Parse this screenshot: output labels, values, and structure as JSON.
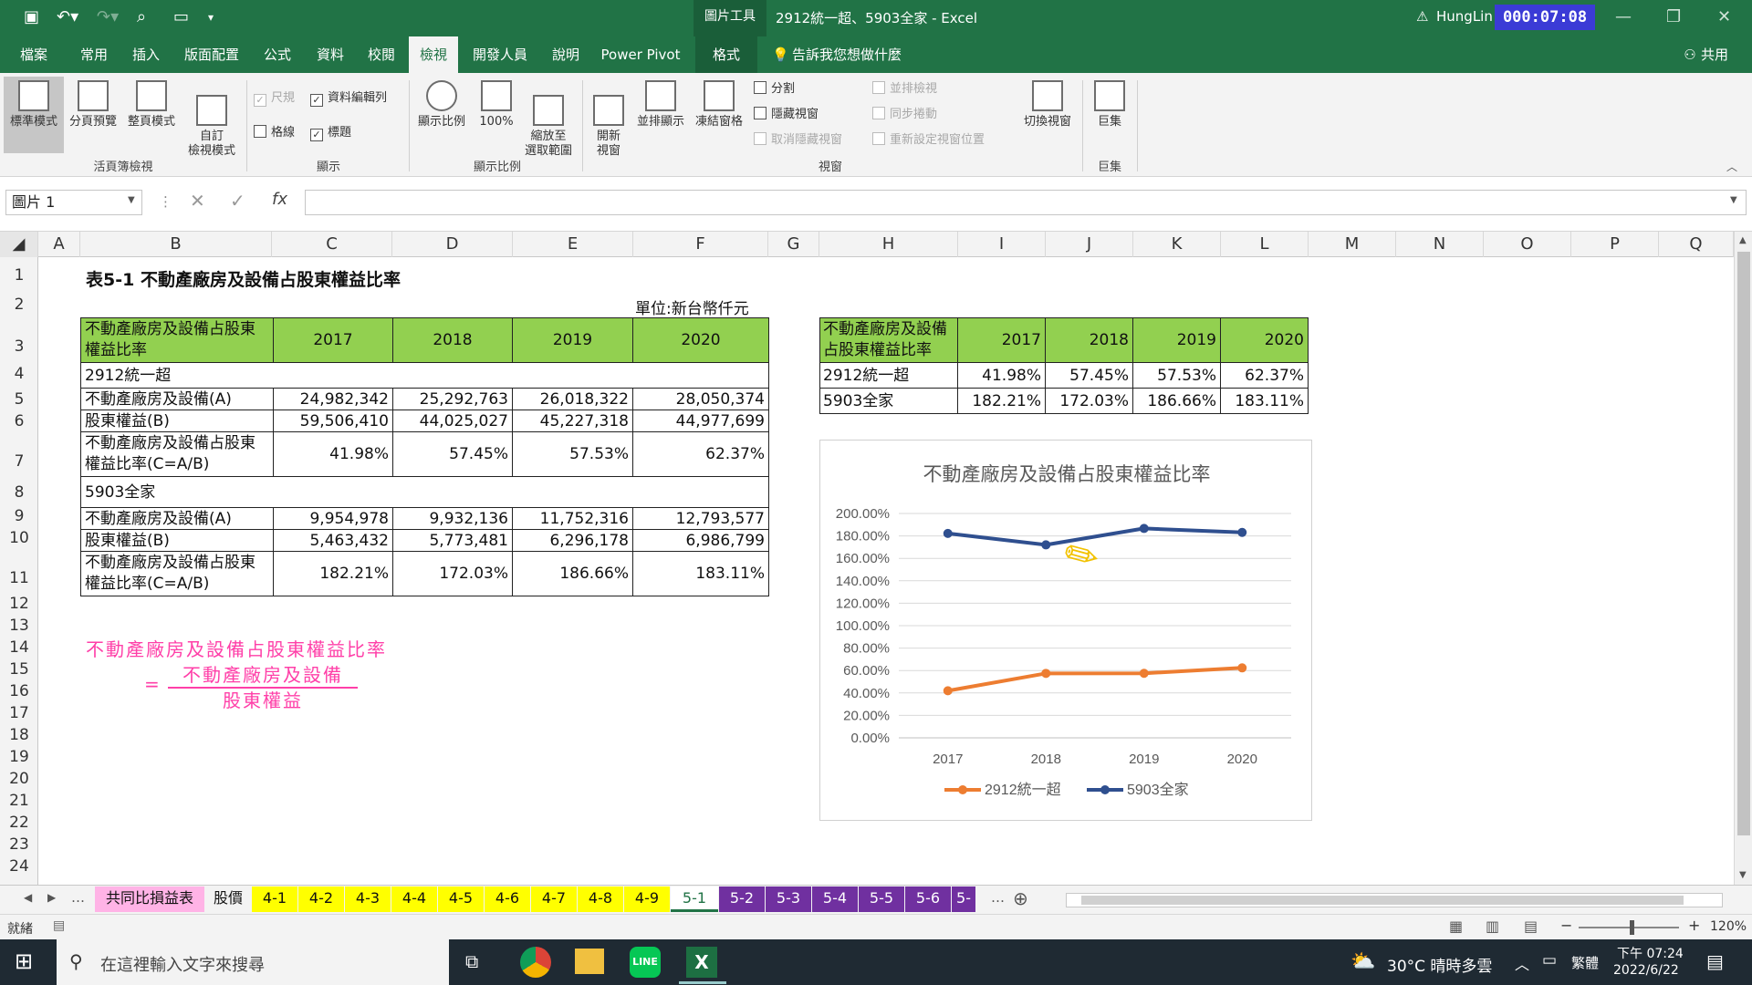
{
  "titlebar": {
    "context_tab": "圖片工具",
    "title": "2912統一超、5903全家 - Excel",
    "user": "HungLin",
    "recording_time": "000:07:08"
  },
  "ribbon_tabs": [
    "檔案",
    "常用",
    "插入",
    "版面配置",
    "公式",
    "資料",
    "校閱",
    "檢視",
    "開發人員",
    "說明",
    "Power Pivot",
    "格式"
  ],
  "active_tab": "檢視",
  "tell_me": "告訴我您想做什麼",
  "share": "共用",
  "ribbon": {
    "normal": "標準模式",
    "page_break": "分頁預覽",
    "page_layout": "整頁模式",
    "custom_view": "自訂\n檢視模式",
    "group_workbook_views": "活頁簿檢視",
    "ruler": "尺規",
    "formula_bar": "資料編輯列",
    "gridlines": "格線",
    "headings": "標題",
    "group_show": "顯示",
    "zoom": "顯示比例",
    "zoom100": "100%",
    "zoom_selection": "縮放至\n選取範圍",
    "group_zoom": "顯示比例",
    "new_window": "開新\n視窗",
    "arrange_all": "並排顯示",
    "freeze": "凍結窗格",
    "split": "分割",
    "hide": "隱藏視窗",
    "unhide": "取消隱藏視窗",
    "side_by_side": "並排檢視",
    "sync_scroll": "同步捲動",
    "reset_pos": "重新設定視窗位置",
    "switch_windows": "切換視窗",
    "group_window": "視窗",
    "macros": "巨集",
    "group_macros": "巨集"
  },
  "namebox": "圖片 1",
  "columns": [
    "A",
    "B",
    "C",
    "D",
    "E",
    "F",
    "G",
    "H",
    "I",
    "J",
    "K",
    "L",
    "M",
    "N",
    "O",
    "P",
    "Q"
  ],
  "rows": [
    "1",
    "2",
    "3",
    "4",
    "5",
    "6",
    "7",
    "8",
    "9",
    "10",
    "11",
    "12",
    "13",
    "14",
    "15",
    "16",
    "17",
    "18",
    "19",
    "20",
    "21",
    "22",
    "23",
    "24"
  ],
  "sheet": {
    "title": "表5-1 不動產廠房及設備占股東權益比率",
    "unit": "單位:新台幣仟元",
    "header_label": "不動產廠房及設備占股東權益比率",
    "years": [
      "2017",
      "2018",
      "2019",
      "2020"
    ],
    "company1": "2912統一超",
    "company2": "5903全家",
    "row_ppe": "不動產廠房及設備(A)",
    "row_equity": "股東權益(B)",
    "row_ratio": "不動產廠房及設備占股東權益比率(C=A/B)",
    "c1_ppe": [
      "24,982,342",
      "25,292,763",
      "26,018,322",
      "28,050,374"
    ],
    "c1_equity": [
      "59,506,410",
      "44,025,027",
      "45,227,318",
      "44,977,699"
    ],
    "c1_ratio": [
      "41.98%",
      "57.45%",
      "57.53%",
      "62.37%"
    ],
    "c2_ppe": [
      "9,954,978",
      "9,932,136",
      "11,752,316",
      "12,793,577"
    ],
    "c2_equity": [
      "5,463,432",
      "5,773,481",
      "6,296,178",
      "6,986,799"
    ],
    "c2_ratio": [
      "182.21%",
      "172.03%",
      "186.66%",
      "183.11%"
    ],
    "formula_line1": "不動產廠房及設備占股東權益比率",
    "formula_eq": "=",
    "formula_num": "不動產廠房及設備",
    "formula_den": "股東權益",
    "summary_header": "不動產廠房及設備占股東權益比率"
  },
  "chart_data": {
    "type": "line",
    "title": "不動產廠房及設備占股東權益比率",
    "categories": [
      "2017",
      "2018",
      "2019",
      "2020"
    ],
    "series": [
      {
        "name": "2912統一超",
        "values": [
          41.98,
          57.45,
          57.53,
          62.37
        ],
        "color": "#ed7d31"
      },
      {
        "name": "5903全家",
        "values": [
          182.21,
          172.03,
          186.66,
          183.11
        ],
        "color": "#2f4f8f"
      }
    ],
    "ylim": [
      0,
      200
    ],
    "yticks": [
      "200.00%",
      "180.00%",
      "160.00%",
      "140.00%",
      "120.00%",
      "100.00%",
      "80.00%",
      "60.00%",
      "40.00%",
      "20.00%",
      "0.00%"
    ],
    "grid": true,
    "legend": "bottom"
  },
  "sheet_tabs": [
    {
      "label": "共同比損益表",
      "color": "#ffb3e6"
    },
    {
      "label": "股價",
      "color": "#f3f3f3"
    },
    {
      "label": "4-1",
      "color": "#ffff00"
    },
    {
      "label": "4-2",
      "color": "#ffff00"
    },
    {
      "label": "4-3",
      "color": "#ffff00"
    },
    {
      "label": "4-4",
      "color": "#ffff00"
    },
    {
      "label": "4-5",
      "color": "#ffff00"
    },
    {
      "label": "4-6",
      "color": "#ffff00"
    },
    {
      "label": "4-7",
      "color": "#ffff00"
    },
    {
      "label": "4-8",
      "color": "#ffff00"
    },
    {
      "label": "4-9",
      "color": "#ffff00"
    },
    {
      "label": "5-1",
      "color": "#ffffff"
    },
    {
      "label": "5-2",
      "color": "#7030a0"
    },
    {
      "label": "5-3",
      "color": "#7030a0"
    },
    {
      "label": "5-4",
      "color": "#7030a0"
    },
    {
      "label": "5-5",
      "color": "#7030a0"
    },
    {
      "label": "5-6",
      "color": "#7030a0"
    },
    {
      "label": "5-",
      "color": "#7030a0"
    }
  ],
  "status": {
    "ready": "就緒",
    "zoom": "120%"
  },
  "taskbar": {
    "search_placeholder": "在這裡輸入文字來搜尋",
    "weather": "30°C 晴時多雲",
    "ime": "繁體",
    "time": "下午 07:24",
    "date": "2022/6/22"
  }
}
